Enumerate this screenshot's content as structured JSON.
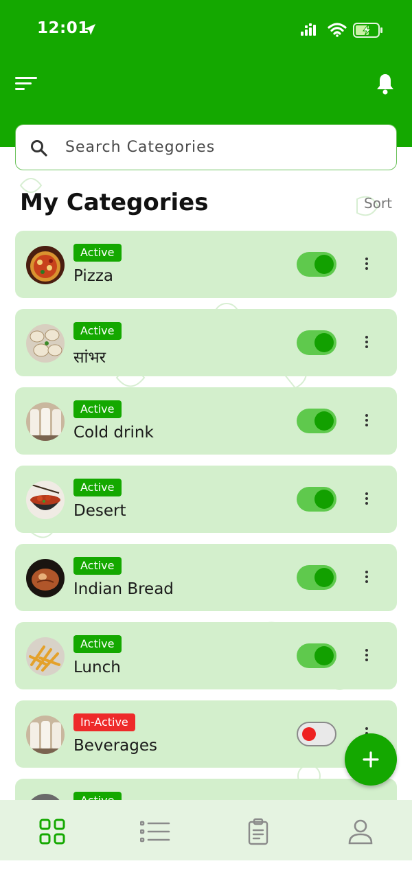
{
  "status_bar": {
    "time": "12:01"
  },
  "header": {
    "menu_icon": "menu-lines-icon",
    "notification_icon": "bell-icon",
    "bg_color": "#14a800"
  },
  "search": {
    "placeholder": "Search Categories",
    "value": ""
  },
  "section": {
    "title": "My Categories",
    "sort_label": "Sort"
  },
  "categories": [
    {
      "name": "Pizza",
      "status": "Active",
      "enabled": true,
      "image": "pizza-thumbnail"
    },
    {
      "name": "सांभर",
      "status": "Active",
      "enabled": true,
      "image": "dumplings-thumbnail"
    },
    {
      "name": "Cold drink",
      "status": "Active",
      "enabled": true,
      "image": "glasses-thumbnail"
    },
    {
      "name": "Desert",
      "status": "Active",
      "enabled": true,
      "image": "bowl-thumbnail"
    },
    {
      "name": "Indian Bread",
      "status": "Active",
      "enabled": true,
      "image": "bread-thumbnail"
    },
    {
      "name": "Lunch",
      "status": "Active",
      "enabled": true,
      "image": "fries-thumbnail"
    },
    {
      "name": "Beverages",
      "status": "In-Active",
      "enabled": false,
      "image": "glasses-thumbnail"
    },
    {
      "name": "",
      "status": "Active",
      "enabled": true,
      "image": "food-thumbnail"
    }
  ],
  "bottom_nav": [
    {
      "icon": "grid-icon",
      "active": true
    },
    {
      "icon": "list-icon",
      "active": false
    },
    {
      "icon": "clipboard-icon",
      "active": false
    },
    {
      "icon": "profile-icon",
      "active": false
    }
  ],
  "colors": {
    "primary": "#14a800",
    "card_bg": "#d3efcc",
    "inactive": "#ee2a2a",
    "nav_bg": "#e5f3e1"
  }
}
